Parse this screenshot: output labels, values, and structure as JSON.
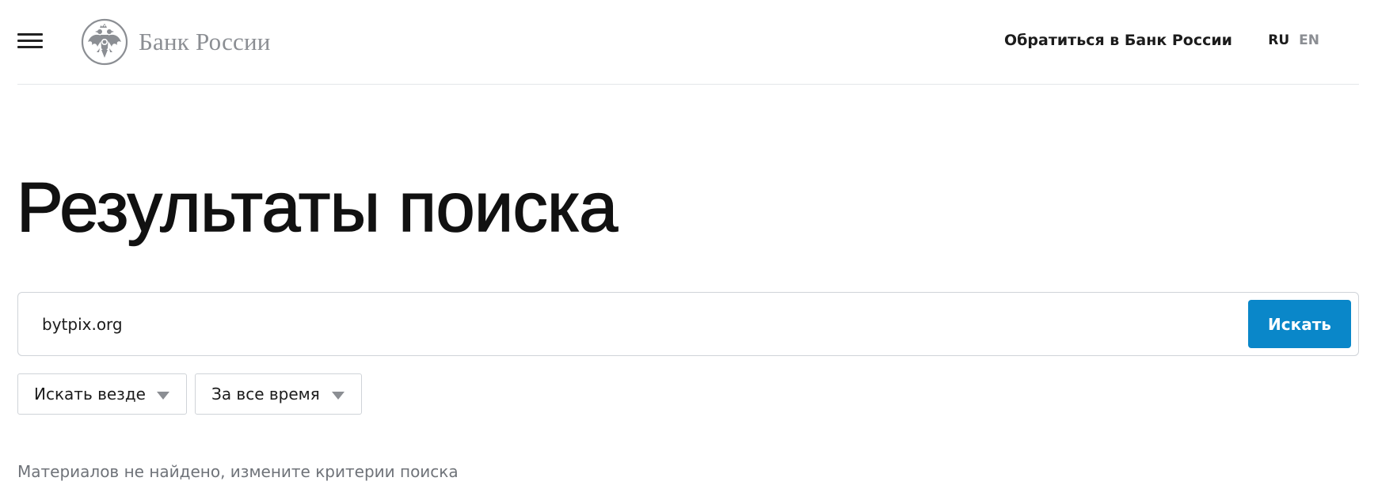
{
  "header": {
    "logo_text": "Банк России",
    "contact_link": "Обратиться в Банк России",
    "lang_ru": "RU",
    "lang_en": "EN"
  },
  "main": {
    "title": "Результаты поиска",
    "search": {
      "value": "bytpix.org",
      "button_label": "Искать"
    },
    "filters": {
      "scope": "Искать везде",
      "period": "За все время"
    },
    "empty_message": "Материалов не найдено, измените критерии поиска"
  },
  "colors": {
    "accent": "#0a87c9",
    "logo_grey": "#8b8e93",
    "text": "#111111",
    "muted_text": "#6f7379"
  },
  "icons": {
    "menu": "menu-icon",
    "emblem": "eagle-emblem-icon",
    "dropdown": "chevron-down-icon"
  }
}
